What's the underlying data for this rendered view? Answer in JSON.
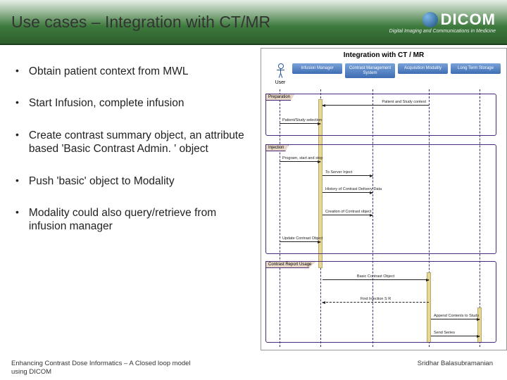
{
  "header": {
    "title": "Use cases – Integration with CT/MR",
    "logo": {
      "name": "DICOM",
      "tagline": "Digital Imaging and Communications in Medicine"
    }
  },
  "bullets": [
    "Obtain patient context from MWL",
    "Start Infusion, complete infusion",
    "Create contrast summary object, an attribute based 'Basic Contrast Admin. ' object",
    "Push 'basic' object to Modality",
    "Modality could also query/retrieve from infusion manager"
  ],
  "diagram": {
    "title": "Integration with CT / MR",
    "actors": {
      "user": "User",
      "a1": "Infusion Manager",
      "a2": "Contrast Management System",
      "a3": "Acquisition Modality",
      "a4": "Long Term Storage"
    },
    "fragments": {
      "f1": "Preparation",
      "f2": "Injection",
      "f3": "Contrast Report Usage"
    },
    "messages": {
      "m1": "Patient and Study context",
      "m2": "Patient/Study selection",
      "m3": "Program, start and stop",
      "m4": "To Server Inject",
      "m5": "History of Contrast Delivery Data",
      "m6": "Creation of Contrast object",
      "m7": "Update Contrast Object",
      "m8": "Basic Contrast Object",
      "m9": "Find Injection S R",
      "m10": "Append Contents to Study",
      "m11": "Send Series"
    }
  },
  "footer": {
    "left": "Enhancing Contrast Dose Informatics – A Closed loop model using DICOM",
    "right": "Sridhar Balasubramanian"
  }
}
